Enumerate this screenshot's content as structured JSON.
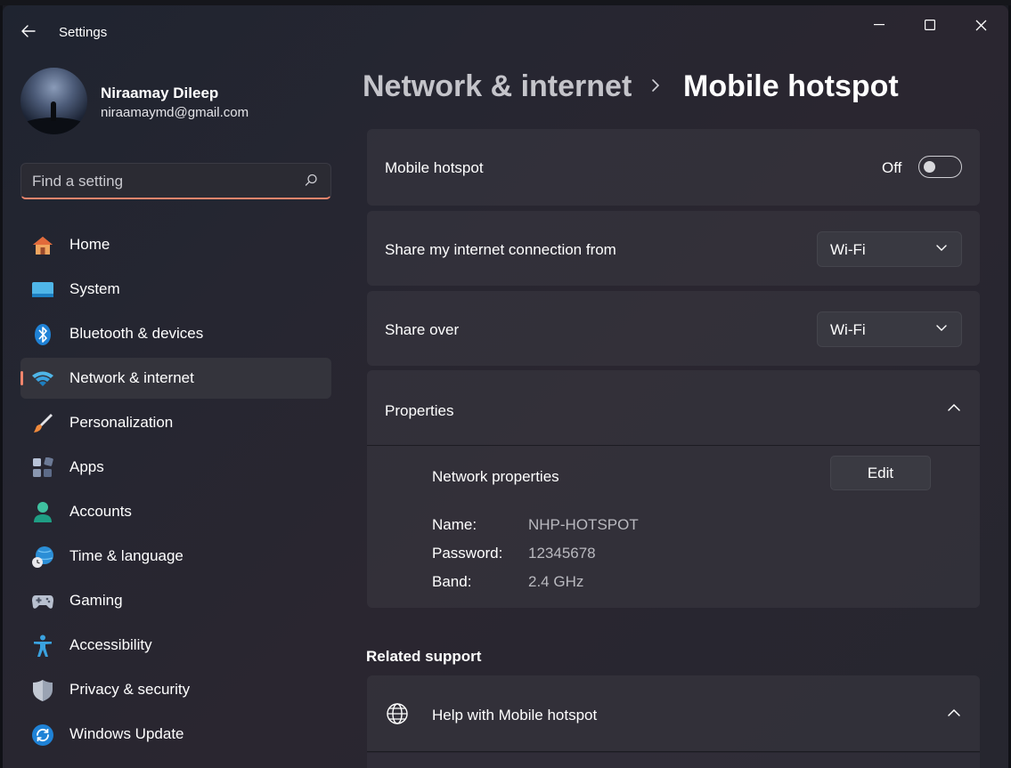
{
  "window": {
    "title": "Settings"
  },
  "profile": {
    "name": "Niraamay Dileep",
    "email": "niraamaymd@gmail.com"
  },
  "search": {
    "placeholder": "Find a setting",
    "icon": "search-icon"
  },
  "sidebar": {
    "items": [
      {
        "label": "Home",
        "icon": "home-icon"
      },
      {
        "label": "System",
        "icon": "monitor-icon"
      },
      {
        "label": "Bluetooth & devices",
        "icon": "bluetooth-icon"
      },
      {
        "label": "Network & internet",
        "icon": "wifi-icon",
        "active": true
      },
      {
        "label": "Personalization",
        "icon": "brush-icon"
      },
      {
        "label": "Apps",
        "icon": "apps-icon"
      },
      {
        "label": "Accounts",
        "icon": "person-icon"
      },
      {
        "label": "Time & language",
        "icon": "globe-clock-icon"
      },
      {
        "label": "Gaming",
        "icon": "gamepad-icon"
      },
      {
        "label": "Accessibility",
        "icon": "accessibility-icon"
      },
      {
        "label": "Privacy & security",
        "icon": "shield-icon"
      },
      {
        "label": "Windows Update",
        "icon": "update-icon"
      }
    ]
  },
  "breadcrumb": {
    "parent": "Network & internet",
    "current": "Mobile hotspot"
  },
  "hotspot": {
    "label": "Mobile hotspot",
    "state_text": "Off",
    "enabled": false
  },
  "share_from": {
    "label": "Share my internet connection from",
    "value": "Wi-Fi"
  },
  "share_over": {
    "label": "Share over",
    "value": "Wi-Fi"
  },
  "properties": {
    "label": "Properties",
    "network_title": "Network properties",
    "edit_label": "Edit",
    "fields": [
      {
        "key": "Name:",
        "value": "NHP-HOTSPOT"
      },
      {
        "key": "Password:",
        "value": "12345678"
      },
      {
        "key": "Band:",
        "value": "2.4 GHz"
      }
    ]
  },
  "related": {
    "title": "Related support",
    "help_label": "Help with Mobile hotspot"
  },
  "colors": {
    "accent": "#f2856c",
    "background": "#26262f",
    "card": "#3a3842"
  }
}
